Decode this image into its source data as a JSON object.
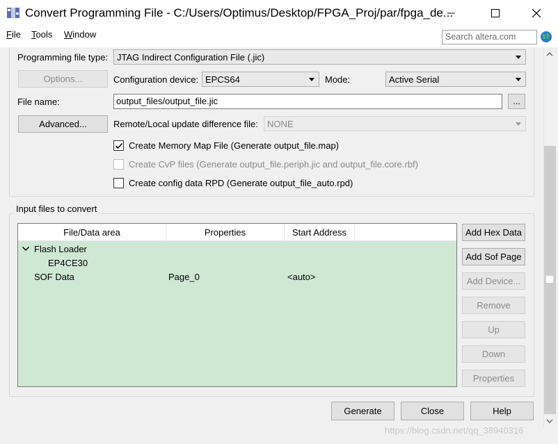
{
  "window": {
    "title": "Convert Programming File - C:/Users/Optimus/Desktop/FPGA_Proj/par/fpga_de...",
    "app_icon": "quartus-convert-icon"
  },
  "menu": {
    "items": [
      {
        "label": "File",
        "mnemonic": "F"
      },
      {
        "label": "Tools",
        "mnemonic": "T"
      },
      {
        "label": "Window",
        "mnemonic": "W"
      }
    ],
    "search_placeholder": "Search altera.com"
  },
  "output_settings": {
    "programming_file_type_label": "Programming file type:",
    "programming_file_type_value": "JTAG Indirect Configuration File (.jic)",
    "options_button": "Options...",
    "configuration_device_label": "Configuration device:",
    "configuration_device_value": "EPCS64",
    "mode_label": "Mode:",
    "mode_value": "Active Serial",
    "file_name_label": "File name:",
    "file_name_value": "output_files/output_file.jic",
    "browse_button": "...",
    "advanced_button": "Advanced...",
    "remote_local_label": "Remote/Local update difference file:",
    "remote_local_value": "NONE",
    "checkboxes": [
      {
        "label": "Create Memory Map File (Generate output_file.map)",
        "checked": true,
        "enabled": true
      },
      {
        "label": "Create CvP files (Generate output_file.periph.jic and output_file.core.rbf)",
        "checked": false,
        "enabled": false
      },
      {
        "label": "Create config data RPD (Generate output_file_auto.rpd)",
        "checked": false,
        "enabled": true
      }
    ]
  },
  "input_files": {
    "group_title": "Input files to convert",
    "columns": [
      "File/Data area",
      "Properties",
      "Start Address"
    ],
    "rows": [
      {
        "file": "Flash Loader",
        "properties": "",
        "start": "",
        "expanded": true
      },
      {
        "file": "EP4CE30",
        "properties": "",
        "start": ""
      },
      {
        "file": "SOF Data",
        "properties": "Page_0",
        "start": "<auto>"
      }
    ],
    "buttons": [
      {
        "label": "Add Hex Data",
        "enabled": true
      },
      {
        "label": "Add Sof Page",
        "enabled": true
      },
      {
        "label": "Add Device...",
        "enabled": false
      },
      {
        "label": "Remove",
        "enabled": false
      },
      {
        "label": "Up",
        "enabled": false
      },
      {
        "label": "Down",
        "enabled": false
      },
      {
        "label": "Properties",
        "enabled": false
      }
    ]
  },
  "footer": {
    "generate": "Generate",
    "close": "Close",
    "help": "Help"
  },
  "watermark": "https://blog.csdn.net/qq_38940316",
  "colors": {
    "table_bg": "#cfe8d3",
    "window_bg": "#f0f0f0"
  }
}
